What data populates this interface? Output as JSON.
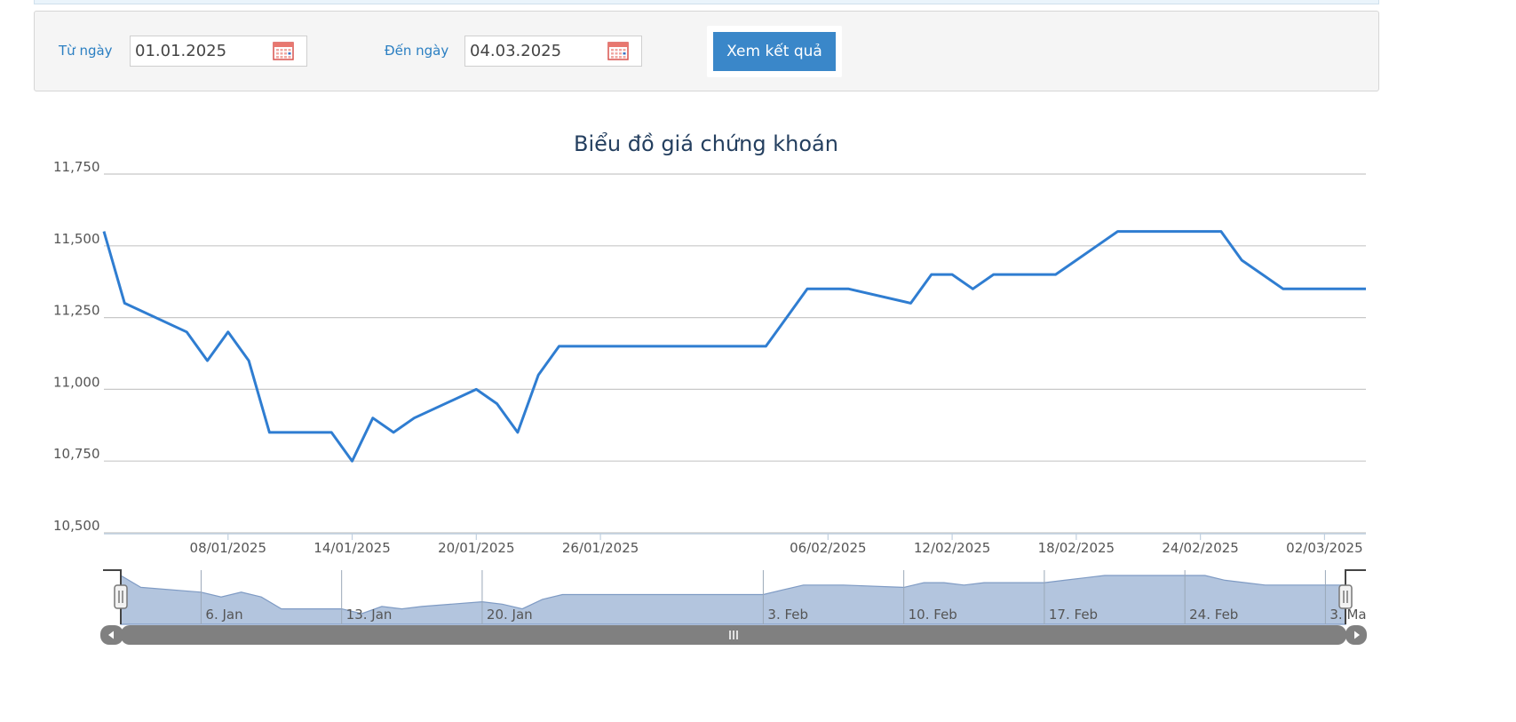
{
  "filter": {
    "from_label": "Từ ngày",
    "from_value": "01.01.2025",
    "to_label": "Đến ngày",
    "to_value": "04.03.2025",
    "submit_label": "Xem kết quả"
  },
  "colors": {
    "accent": "#3a87c9",
    "line": "#2f7dd1",
    "navigator_fill": "#b3c5de",
    "navigator_line": "#7f9bc4",
    "scrollbar": "#808080"
  },
  "icons": {
    "calendar": "calendar-icon",
    "scroll_left": "triangle-left",
    "scroll_right": "triangle-right",
    "grip": "grip-lines"
  },
  "chart_data": {
    "type": "line",
    "title": "Biểu đồ giá chứng khoán",
    "xlabel": "",
    "ylabel": "",
    "ylim": [
      10500,
      11750
    ],
    "yticks": [
      10500,
      10750,
      11000,
      11250,
      11500,
      11750
    ],
    "ytick_labels": [
      "10,500",
      "10,750",
      "11,000",
      "11,250",
      "11,500",
      "11,750"
    ],
    "grid": true,
    "x_tick_labels": [
      {
        "date": "2025-01-08",
        "label": "08/01/2025"
      },
      {
        "date": "2025-01-14",
        "label": "14/01/2025"
      },
      {
        "date": "2025-01-20",
        "label": "20/01/2025"
      },
      {
        "date": "2025-01-26",
        "label": "26/01/2025"
      },
      {
        "date": "2025-02-06",
        "label": "06/02/2025"
      },
      {
        "date": "2025-02-12",
        "label": "12/02/2025"
      },
      {
        "date": "2025-02-18",
        "label": "18/02/2025"
      },
      {
        "date": "2025-02-24",
        "label": "24/02/2025"
      },
      {
        "date": "2025-03-02",
        "label": "02/03/2025"
      }
    ],
    "series": [
      {
        "x": [
          "2025-01-02",
          "2025-01-03",
          "2025-01-06",
          "2025-01-07",
          "2025-01-08",
          "2025-01-09",
          "2025-01-10",
          "2025-01-13",
          "2025-01-14",
          "2025-01-15",
          "2025-01-16",
          "2025-01-17",
          "2025-01-20",
          "2025-01-21",
          "2025-01-22",
          "2025-01-23",
          "2025-01-24",
          "2025-02-03",
          "2025-02-04",
          "2025-02-05",
          "2025-02-06",
          "2025-02-07",
          "2025-02-10",
          "2025-02-11",
          "2025-02-12",
          "2025-02-13",
          "2025-02-14",
          "2025-02-17",
          "2025-02-18",
          "2025-02-19",
          "2025-02-20",
          "2025-02-21",
          "2025-02-24",
          "2025-02-25",
          "2025-02-26",
          "2025-02-27",
          "2025-02-28",
          "2025-03-03",
          "2025-03-04"
        ],
        "values": [
          11550,
          11300,
          11200,
          11100,
          11200,
          11100,
          10850,
          10850,
          10750,
          10900,
          10850,
          10900,
          11000,
          10950,
          10850,
          11050,
          11150,
          11150,
          11250,
          11350,
          11350,
          11350,
          11300,
          11400,
          11400,
          11350,
          11400,
          11400,
          11450,
          11500,
          11550,
          11550,
          11550,
          11550,
          11450,
          11400,
          11350,
          11350,
          11350
        ]
      }
    ],
    "navigator": {
      "tick_labels": [
        "6. Jan",
        "13. Jan",
        "20. Jan",
        "3. Feb",
        "10. Feb",
        "17. Feb",
        "24. Feb",
        "3. Ma"
      ]
    }
  }
}
